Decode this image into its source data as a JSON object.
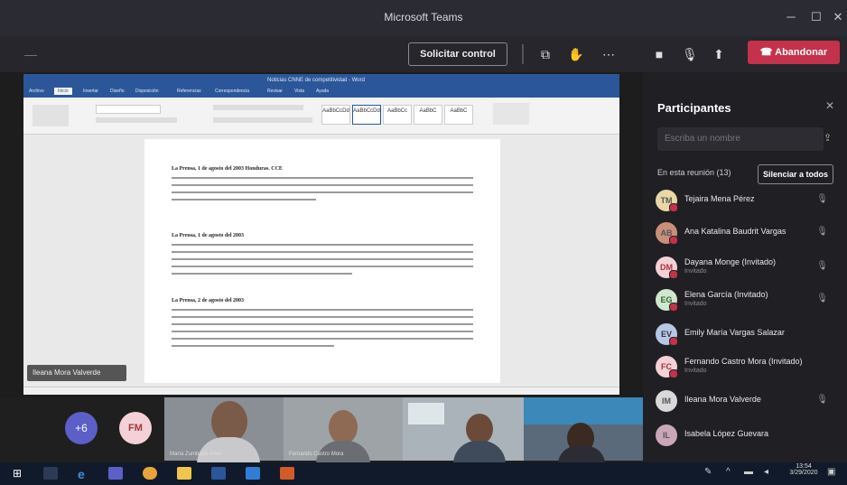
{
  "window": {
    "title": "Microsoft Teams"
  },
  "meeting_bar": {
    "request_control_label": "Solicitar control",
    "leave_label": "Abandonar"
  },
  "word": {
    "title": "Noticias CNNE de competitividad - Word",
    "tabs": [
      "Archivo",
      "Inicio",
      "Insertar",
      "Diseño",
      "Disposición",
      "Referencias",
      "Correspondencia",
      "Revisar",
      "Vista",
      "Ayuda"
    ],
    "styles": [
      "AaBbCcDd",
      "AaBbCcDd",
      "AaBbCc",
      "AaBbC",
      "AaBbC"
    ],
    "paragraphs": [
      {
        "title": "La Prensa, 1 de agosto del 2003 Honduras. CCE"
      },
      {
        "title": "La Prensa, 1 de agosto del 2003"
      },
      {
        "title": "La Prensa, 2 de agosto del 2003"
      }
    ]
  },
  "presenter_chip": "Ileana Mora Valverde",
  "panel": {
    "title": "Participantes",
    "invite_placeholder": "Escriba un nombre",
    "in_meeting": "En esta reunión (13)",
    "mute_all_label": "Silenciar a todos",
    "participants": [
      {
        "name": "Tejaira Mena Pérez",
        "sub": "",
        "initials": "TM"
      },
      {
        "name": "Ana Katalina Baudrit Vargas",
        "sub": "",
        "initials": "AB"
      },
      {
        "name": "Dayana Monge (Invitado)",
        "sub": "Invitado",
        "initials": "DM"
      },
      {
        "name": "Elena García (Invitado)",
        "sub": "Invitado",
        "initials": "EG"
      },
      {
        "name": "Emily María Vargas Salazar",
        "sub": "",
        "initials": "EV"
      },
      {
        "name": "Fernando Castro Mora (Invitado)",
        "sub": "Invitado",
        "initials": "FC"
      },
      {
        "name": "Ileana Mora Valverde",
        "sub": "",
        "initials": "IM"
      },
      {
        "name": "Isabela López Guevara",
        "sub": "",
        "initials": "IL"
      }
    ]
  },
  "video_strip": {
    "overflow_label": "+6",
    "fm_initials": "FM",
    "tiles": [
      {
        "name": "María Zumbado Arias"
      },
      {
        "name": "Fernando Castro Mora"
      },
      {
        "name": ""
      },
      {
        "name": ""
      }
    ]
  },
  "taskbar": {
    "time": "13:54",
    "date": "3/29/2020"
  }
}
